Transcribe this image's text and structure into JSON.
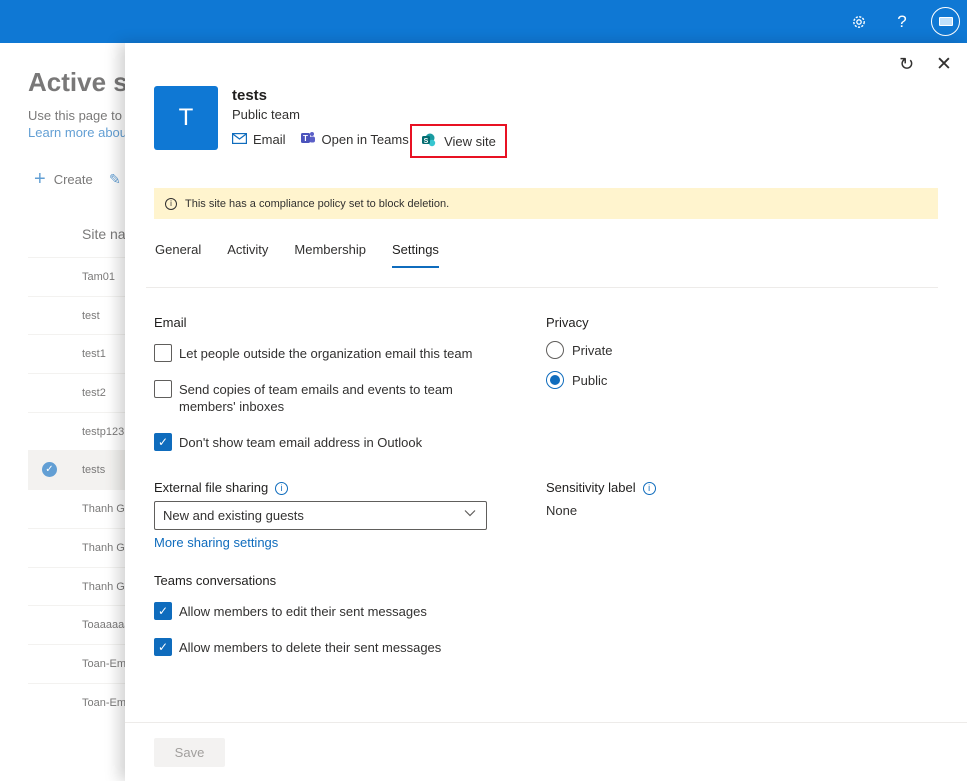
{
  "background": {
    "title": "Active si",
    "description": "Use this page to",
    "learn_more": "Learn more abou",
    "create_label": "Create",
    "column_header": "Site nar",
    "rows": [
      {
        "label": "Tam01",
        "selected": false
      },
      {
        "label": "test",
        "selected": false
      },
      {
        "label": "test1",
        "selected": false
      },
      {
        "label": "test2",
        "selected": false
      },
      {
        "label": "testp123",
        "selected": false
      },
      {
        "label": "tests",
        "selected": true
      },
      {
        "label": "Thanh G",
        "selected": false
      },
      {
        "label": "Thanh G",
        "selected": false
      },
      {
        "label": "Thanh G",
        "selected": false
      },
      {
        "label": "Toaaaaaa",
        "selected": false
      },
      {
        "label": "Toan-Em",
        "selected": false
      },
      {
        "label": "Toan-Em",
        "selected": false
      }
    ]
  },
  "topbar": {
    "icons": [
      "gear-icon",
      "help-icon",
      "account-icon"
    ],
    "help_glyph": "?"
  },
  "panel": {
    "avatar_letter": "T",
    "team_name": "tests",
    "team_type": "Public team",
    "actions": {
      "email": "Email",
      "open_in_teams": "Open in Teams",
      "view_site": "View site"
    },
    "banner": "This site has a compliance policy set to block deletion.",
    "tabs": [
      "General",
      "Activity",
      "Membership",
      "Settings"
    ],
    "active_tab": "Settings",
    "email_section": {
      "label": "Email",
      "options": [
        {
          "text": "Let people outside the organization email this team",
          "checked": false
        },
        {
          "text": "Send copies of team emails and events to team members' inboxes",
          "checked": false
        },
        {
          "text": "Don't show team email address in Outlook",
          "checked": true
        }
      ]
    },
    "privacy_section": {
      "label": "Privacy",
      "options": [
        {
          "text": "Private",
          "selected": false
        },
        {
          "text": "Public",
          "selected": true
        }
      ]
    },
    "external_sharing": {
      "label": "External file sharing",
      "value": "New and existing guests",
      "more_link": "More sharing settings"
    },
    "sensitivity": {
      "label": "Sensitivity label",
      "value": "None"
    },
    "teams_conversations": {
      "label": "Teams conversations",
      "options": [
        {
          "text": "Allow members to edit their sent messages",
          "checked": true
        },
        {
          "text": "Allow members to delete their sent messages",
          "checked": true
        }
      ]
    },
    "save_label": "Save",
    "accent_color": "#0f6cbd",
    "topbar_color": "#0f78d4",
    "banner_color": "#fff4ce",
    "highlight_color": "#e81123"
  }
}
